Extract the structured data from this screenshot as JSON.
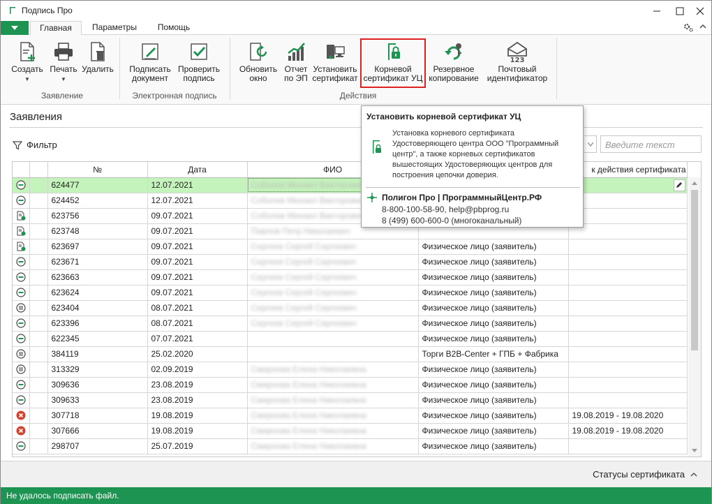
{
  "window": {
    "title": "Подпись Про"
  },
  "tabs": [
    {
      "label": "Главная",
      "active": true
    },
    {
      "label": "Параметры",
      "active": false
    },
    {
      "label": "Помощь",
      "active": false
    }
  ],
  "ribbon": {
    "create": "Создать",
    "print": "Печать",
    "delete": "Удалить",
    "group_statement": "Заявление",
    "sign_doc_1": "Подписать",
    "sign_doc_2": "документ",
    "verify_1": "Проверить",
    "verify_2": "подпись",
    "group_esign": "Электронная подпись",
    "refresh_1": "Обновить",
    "refresh_2": "окно",
    "report_1": "Отчет",
    "report_2": "по ЭП",
    "install_1": "Установить",
    "install_2": "сертификат",
    "root_1": "Корневой",
    "root_2": "сертификат УЦ",
    "backup_1": "Резервное",
    "backup_2": "копирование",
    "mail_1": "Почтовый",
    "mail_2": "идентификатор",
    "group_actions": "Действия"
  },
  "content": {
    "section_title": "Заявления",
    "filter_label": "Фильтр",
    "search_placeholder": "Введите текст"
  },
  "grid": {
    "columns": [
      "№",
      "Дата",
      "ФИО",
      "",
      "к действия сертификата"
    ],
    "rows": [
      {
        "status": "green",
        "num": "624477",
        "date": "12.07.2021",
        "fio": "Соболев Михаил Викторович",
        "type": "",
        "validity": "",
        "selected": true
      },
      {
        "status": "green",
        "num": "624452",
        "date": "12.07.2021",
        "fio": "Соболев Михаил Викторович",
        "type": "",
        "validity": ""
      },
      {
        "status": "doc",
        "num": "623756",
        "date": "09.07.2021",
        "fio": "Соболев Михаил Викторович",
        "type": "",
        "validity": ""
      },
      {
        "status": "doc",
        "num": "623748",
        "date": "09.07.2021",
        "fio": "Павлов Петр Николаевич",
        "type": "",
        "validity": ""
      },
      {
        "status": "doc",
        "num": "623697",
        "date": "09.07.2021",
        "fio": "Сергеев Сергей Сергеевич",
        "type": "Физическое лицо (заявитель)",
        "validity": ""
      },
      {
        "status": "green",
        "num": "623671",
        "date": "09.07.2021",
        "fio": "Сергеев Сергей Сергеевич",
        "type": "Физическое лицо (заявитель)",
        "validity": ""
      },
      {
        "status": "green",
        "num": "623663",
        "date": "09.07.2021",
        "fio": "Сергеев Сергей Сергеевич",
        "type": "Физическое лицо (заявитель)",
        "validity": ""
      },
      {
        "status": "green",
        "num": "623624",
        "date": "09.07.2021",
        "fio": "Сергеев Сергей Сергеевич",
        "type": "Физическое лицо (заявитель)",
        "validity": ""
      },
      {
        "status": "list",
        "num": "623404",
        "date": "08.07.2021",
        "fio": "Сергеев Сергей Сергеевич",
        "type": "Физическое лицо (заявитель)",
        "validity": ""
      },
      {
        "status": "green",
        "num": "623396",
        "date": "08.07.2021",
        "fio": "Сергеев Сергей Сергеевич",
        "type": "Физическое лицо (заявитель)",
        "validity": ""
      },
      {
        "status": "green",
        "num": "622345",
        "date": "07.07.2021",
        "fio": "",
        "type": "Физическое лицо (заявитель)",
        "validity": ""
      },
      {
        "status": "list",
        "num": "384119",
        "date": "25.02.2020",
        "fio": "",
        "type": "Торги B2B-Center + ГПБ + Фабрика",
        "validity": ""
      },
      {
        "status": "list",
        "num": "313329",
        "date": "02.09.2019",
        "fio": "Смирнова Елена Николаевна",
        "type": "Физическое лицо (заявитель)",
        "validity": ""
      },
      {
        "status": "green",
        "num": "309636",
        "date": "23.08.2019",
        "fio": "Смирнова Елена Николаевна",
        "type": "Физическое лицо (заявитель)",
        "validity": ""
      },
      {
        "status": "green",
        "num": "309633",
        "date": "23.08.2019",
        "fio": "Смирнова Елена Николаевна",
        "type": "Физическое лицо (заявитель)",
        "validity": ""
      },
      {
        "status": "red",
        "num": "307718",
        "date": "19.08.2019",
        "fio": "Смирнова Елена Николаевна",
        "type": "Физическое лицо (заявитель)",
        "validity": "19.08.2019 - 19.08.2020"
      },
      {
        "status": "red",
        "num": "307666",
        "date": "19.08.2019",
        "fio": "Смирнова Елена Николаевна",
        "type": "Физическое лицо (заявитель)",
        "validity": "19.08.2019 - 19.08.2020"
      },
      {
        "status": "green",
        "num": "298707",
        "date": "25.07.2019",
        "fio": "Смирнова Елена Николаевна",
        "type": "Физическое лицо (заявитель)",
        "validity": ""
      }
    ]
  },
  "tooltip": {
    "title": "Установить корневой сертификат УЦ",
    "body_1": "Установка корневого сертификата",
    "body_2": "Удостоверяющего центра ООО \"Программный",
    "body_3": "центр\", а также корневых сертификатов",
    "body_4": "вышестоящих Удостоверяющих центров для",
    "body_5": "построения цепочки доверия.",
    "footer_title": "Полигон Про | ПрограммныйЦентр.РФ",
    "footer_line1": "8-800-100-58-90, help@pbprog.ru",
    "footer_line2": "8 (499) 600-600-0 (многоканальный)"
  },
  "bottom": {
    "cert_status": "Статусы сертификата"
  },
  "statusbar": {
    "message": "Не удалось подписать файл."
  },
  "colors": {
    "accent": "#1e9452",
    "selected_row": "#c5f3bc",
    "highlight": "#e02020",
    "error": "#d0442f"
  }
}
